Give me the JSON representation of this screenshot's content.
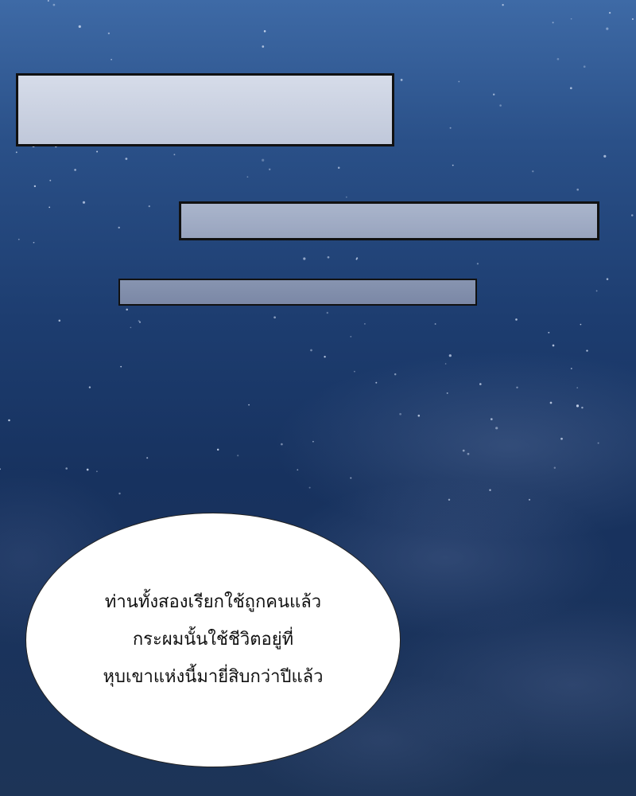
{
  "scene": {
    "background": "night-sky-with-stars-and-clouds",
    "colors": {
      "sky_top": "#3e6aa6",
      "sky_bottom": "#1d3457",
      "caption_border": "#111111",
      "bubble_fill": "#ffffff"
    }
  },
  "caption_boxes": [
    {
      "text": ""
    },
    {
      "text": ""
    },
    {
      "text": ""
    }
  ],
  "speech_bubble": {
    "lines": [
      "ท่านทั้งสองเรียกใช้ถูกคนแล้ว",
      "กระผมนั้นใช้ชีวิตอยู่ที่",
      "หุบเขาแห่งนี้มายี่สิบกว่าปีแล้ว"
    ]
  }
}
